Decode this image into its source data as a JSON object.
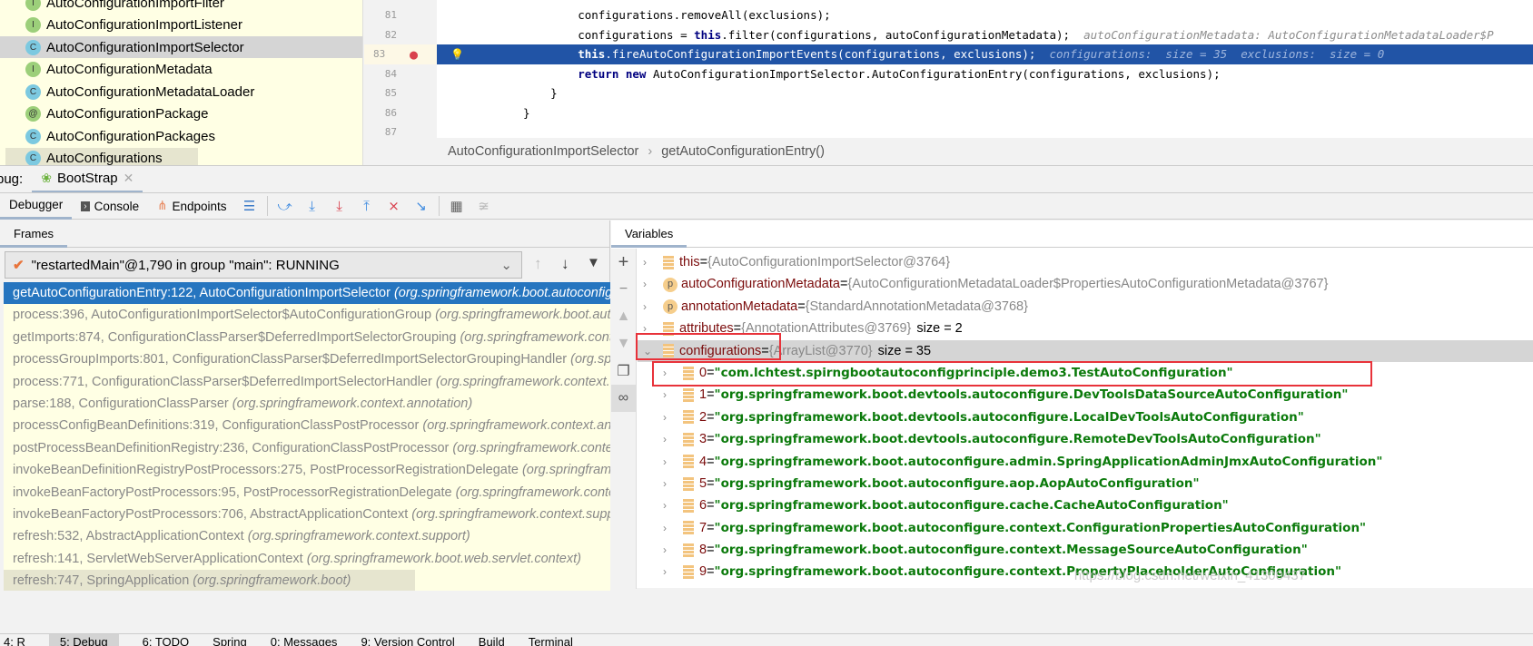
{
  "project_tree": [
    {
      "kind": "I",
      "label": "AutoConfigurationImportFilter"
    },
    {
      "kind": "I",
      "label": "AutoConfigurationImportListener"
    },
    {
      "kind": "C",
      "label": "AutoConfigurationImportSelector",
      "selected": true
    },
    {
      "kind": "I",
      "label": "AutoConfigurationMetadata"
    },
    {
      "kind": "C",
      "label": "AutoConfigurationMetadataLoader"
    },
    {
      "kind": "@",
      "label": "AutoConfigurationPackage"
    },
    {
      "kind": "C",
      "label": "AutoConfigurationPackages"
    },
    {
      "kind": "C",
      "label": "AutoConfigurations"
    }
  ],
  "editor": {
    "lines": [
      {
        "n": "81",
        "code": "        configurations.removeAll(exclusions);"
      },
      {
        "n": "82",
        "pre": "        configurations = ",
        "kw": "this",
        "post": ".filter(configurations, autoConfigurationMetadata);",
        "hint": "  autoConfigurationMetadata: AutoConfigurationMetadataLoader$P"
      },
      {
        "n": "83",
        "kw": "        this",
        "post": ".fireAutoConfigurationImportEvents(configurations, exclusions);",
        "hint": "  configurations:  size = 35  exclusions:  size = 0",
        "current": true
      },
      {
        "n": "84",
        "kw": "        return new",
        "post": " AutoConfigurationImportSelector.AutoConfigurationEntry(configurations, exclusions);"
      },
      {
        "n": "85",
        "code": "    }"
      },
      {
        "n": "86",
        "code": "}"
      },
      {
        "n": "87",
        "code": ""
      }
    ],
    "breadcrumb": [
      "AutoConfigurationImportSelector",
      "getAutoConfigurationEntry()"
    ]
  },
  "debug": {
    "label": "bug:",
    "session_tab": "BootStrap",
    "toolbar": {
      "debugger": "Debugger",
      "console": "Console",
      "endpoints": "Endpoints"
    }
  },
  "frames": {
    "title": "Frames",
    "thread": "\"restartedMain\"@1,790 in group \"main\": RUNNING",
    "items": [
      {
        "m": "getAutoConfigurationEntry:122, AutoConfigurationImportSelector ",
        "p": "(org.springframework.boot.autoconfigure)"
      },
      {
        "m": "process:396, AutoConfigurationImportSelector$AutoConfigurationGroup ",
        "p": "(org.springframework.boot.autoconfigure)"
      },
      {
        "m": "getImports:874, ConfigurationClassParser$DeferredImportSelectorGrouping ",
        "p": "(org.springframework.context.annotation)"
      },
      {
        "m": "processGroupImports:801, ConfigurationClassParser$DeferredImportSelectorGroupingHandler ",
        "p": "(org.springframework.context.annotation)"
      },
      {
        "m": "process:771, ConfigurationClassParser$DeferredImportSelectorHandler ",
        "p": "(org.springframework.context.annotation)"
      },
      {
        "m": "parse:188, ConfigurationClassParser ",
        "p": "(org.springframework.context.annotation)"
      },
      {
        "m": "processConfigBeanDefinitions:319, ConfigurationClassPostProcessor ",
        "p": "(org.springframework.context.annotation)"
      },
      {
        "m": "postProcessBeanDefinitionRegistry:236, ConfigurationClassPostProcessor ",
        "p": "(org.springframework.context.annotation)"
      },
      {
        "m": "invokeBeanDefinitionRegistryPostProcessors:275, PostProcessorRegistrationDelegate ",
        "p": "(org.springframework.context.support)"
      },
      {
        "m": "invokeBeanFactoryPostProcessors:95, PostProcessorRegistrationDelegate ",
        "p": "(org.springframework.context.support)"
      },
      {
        "m": "invokeBeanFactoryPostProcessors:706, AbstractApplicationContext ",
        "p": "(org.springframework.context.support)"
      },
      {
        "m": "refresh:532, AbstractApplicationContext ",
        "p": "(org.springframework.context.support)"
      },
      {
        "m": "refresh:141, ServletWebServerApplicationContext ",
        "p": "(org.springframework.boot.web.servlet.context)"
      },
      {
        "m": "refresh:747, SpringApplication ",
        "p": "(org.springframework.boot)"
      }
    ]
  },
  "variables": {
    "title": "Variables",
    "items": [
      {
        "name": "this",
        "type": "{AutoConfigurationImportSelector@3764}",
        "extra": ""
      },
      {
        "name": "autoConfigurationMetadata",
        "type": "{AutoConfigurationMetadataLoader$PropertiesAutoConfigurationMetadata@3767}",
        "extra": "",
        "param": true
      },
      {
        "name": "annotationMetadata",
        "type": "{StandardAnnotationMetadata@3768}",
        "extra": "",
        "param": true
      },
      {
        "name": "attributes",
        "type": "{AnnotationAttributes@3769}",
        "extra": "size = 2"
      },
      {
        "name": "configurations",
        "type": "{ArrayList@3770}",
        "extra": "size = 35",
        "expanded": true
      }
    ],
    "children": [
      {
        "i": "0",
        "v": "\"com.lchtest.spirngbootautoconfigprinciple.demo3.TestAutoConfiguration\""
      },
      {
        "i": "1",
        "v": "\"org.springframework.boot.devtools.autoconfigure.DevToolsDataSourceAutoConfiguration\""
      },
      {
        "i": "2",
        "v": "\"org.springframework.boot.devtools.autoconfigure.LocalDevToolsAutoConfiguration\""
      },
      {
        "i": "3",
        "v": "\"org.springframework.boot.devtools.autoconfigure.RemoteDevToolsAutoConfiguration\""
      },
      {
        "i": "4",
        "v": "\"org.springframework.boot.autoconfigure.admin.SpringApplicationAdminJmxAutoConfiguration\""
      },
      {
        "i": "5",
        "v": "\"org.springframework.boot.autoconfigure.aop.AopAutoConfiguration\""
      },
      {
        "i": "6",
        "v": "\"org.springframework.boot.autoconfigure.cache.CacheAutoConfiguration\""
      },
      {
        "i": "7",
        "v": "\"org.springframework.boot.autoconfigure.context.ConfigurationPropertiesAutoConfiguration\""
      },
      {
        "i": "8",
        "v": "\"org.springframework.boot.autoconfigure.context.MessageSourceAutoConfiguration\""
      },
      {
        "i": "9",
        "v": "\"org.springframework.boot.autoconfigure.context.PropertyPlaceholderAutoConfiguration\""
      }
    ]
  },
  "bottom_bar": [
    "4: R",
    "5: Debug",
    "6: TODO",
    "Spring",
    "0: Messages",
    "9: Version Control",
    "Build",
    "Terminal"
  ],
  "watermark": "https://blog.csdn.net/weixin_41300437",
  "colors": {
    "highlight": "#2154a6",
    "frame_selected": "#2675bf",
    "string_value": "#0b7a0b",
    "annotation_box": "#e8323a"
  }
}
